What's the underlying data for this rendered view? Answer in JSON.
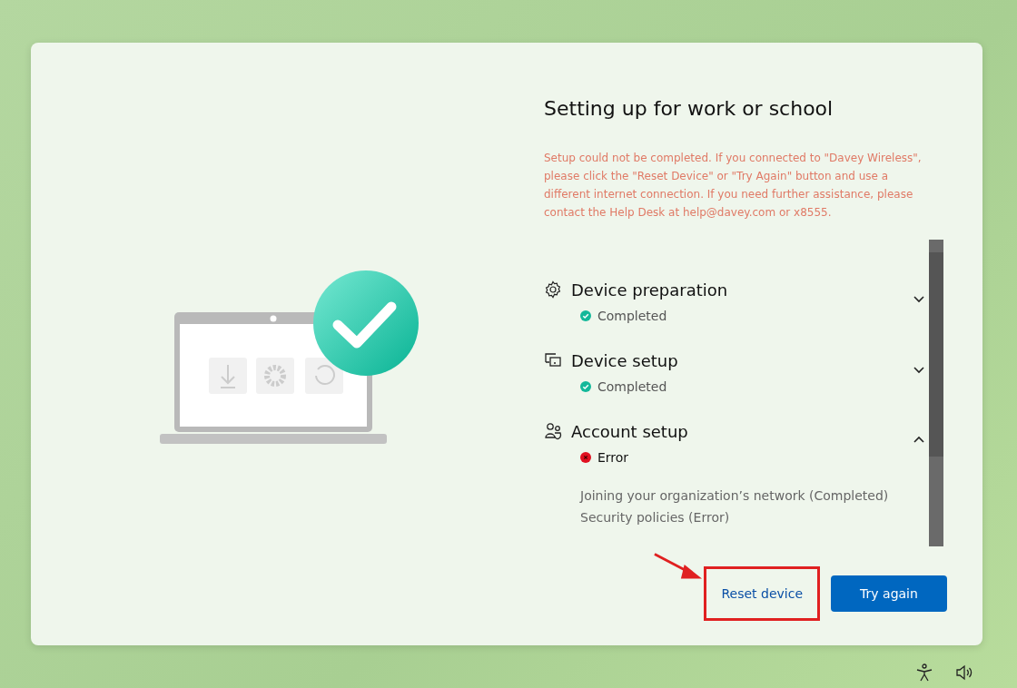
{
  "title": "Setting up for work or school",
  "error_message": "Setup could not be completed. If you connected to \"Davey Wireless\", please click the \"Reset Device\" or \"Try Again\" button and use a different internet connection. If you need further assistance, please contact the Help Desk at help@davey.com or x8555.",
  "steps": [
    {
      "kind": "gear",
      "label": "Device preparation",
      "completed": true,
      "status_text": "Completed",
      "expanded": false
    },
    {
      "kind": "devices",
      "label": "Device setup",
      "completed": true,
      "status_text": "Completed",
      "expanded": false
    },
    {
      "kind": "people",
      "label": "Account setup",
      "completed": false,
      "status_text": "Error",
      "expanded": true,
      "children": [
        {
          "label": "Joining your organization’s network (Completed)"
        },
        {
          "label": "Security policies (Error)"
        }
      ]
    }
  ],
  "buttons": [
    {
      "label": "Reset device",
      "kind": "link",
      "highlighted": true
    },
    {
      "label": "Try again",
      "kind": "primary",
      "highlighted": false
    }
  ]
}
